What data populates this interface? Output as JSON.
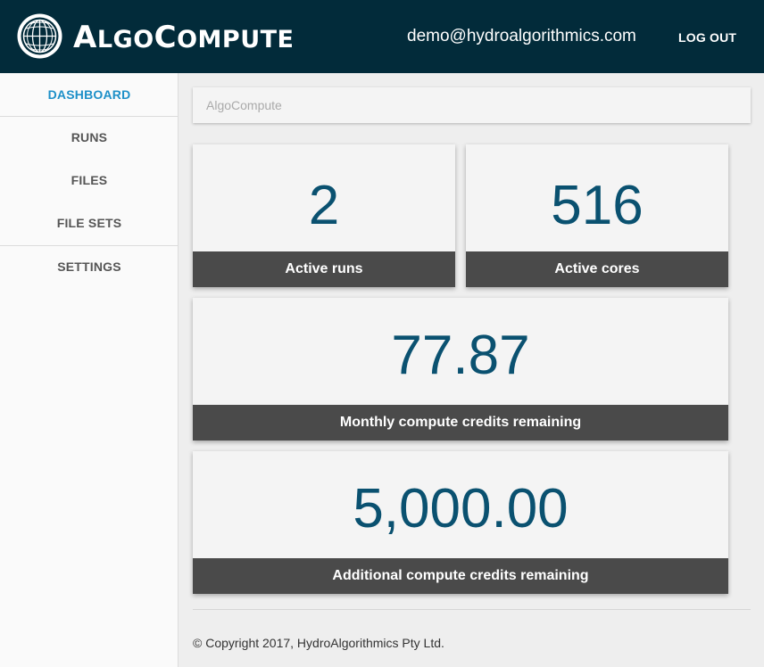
{
  "header": {
    "brand": "ALGOCOMPUTE",
    "brand_parts": [
      "A",
      "LGO",
      "C",
      "OMPUTE"
    ],
    "user_email": "demo@hydroalgorithmics.com",
    "logout_label": "LOG OUT",
    "logo_icon": "globe-icon",
    "background_color": "#022b3a"
  },
  "sidebar": {
    "items": [
      {
        "label": "DASHBOARD",
        "active": true
      },
      {
        "label": "RUNS",
        "active": false
      },
      {
        "label": "FILES",
        "active": false
      },
      {
        "label": "FILE SETS",
        "active": false
      },
      {
        "label": "SETTINGS",
        "active": false
      }
    ],
    "active_color": "#1e90c8"
  },
  "breadcrumb": {
    "text": "AlgoCompute"
  },
  "stats": {
    "active_runs": {
      "value": "2",
      "label": "Active runs"
    },
    "active_cores": {
      "value": "516",
      "label": "Active cores"
    },
    "monthly_credits": {
      "value": "77.87",
      "label": "Monthly compute credits remaining"
    },
    "additional_credits": {
      "value": "5,000.00",
      "label": "Additional compute credits remaining"
    },
    "value_color": "#0a5170",
    "label_bar_color": "#4a4a4a"
  },
  "footer": {
    "copyright": "© Copyright 2017, HydroAlgorithmics Pty Ltd."
  }
}
